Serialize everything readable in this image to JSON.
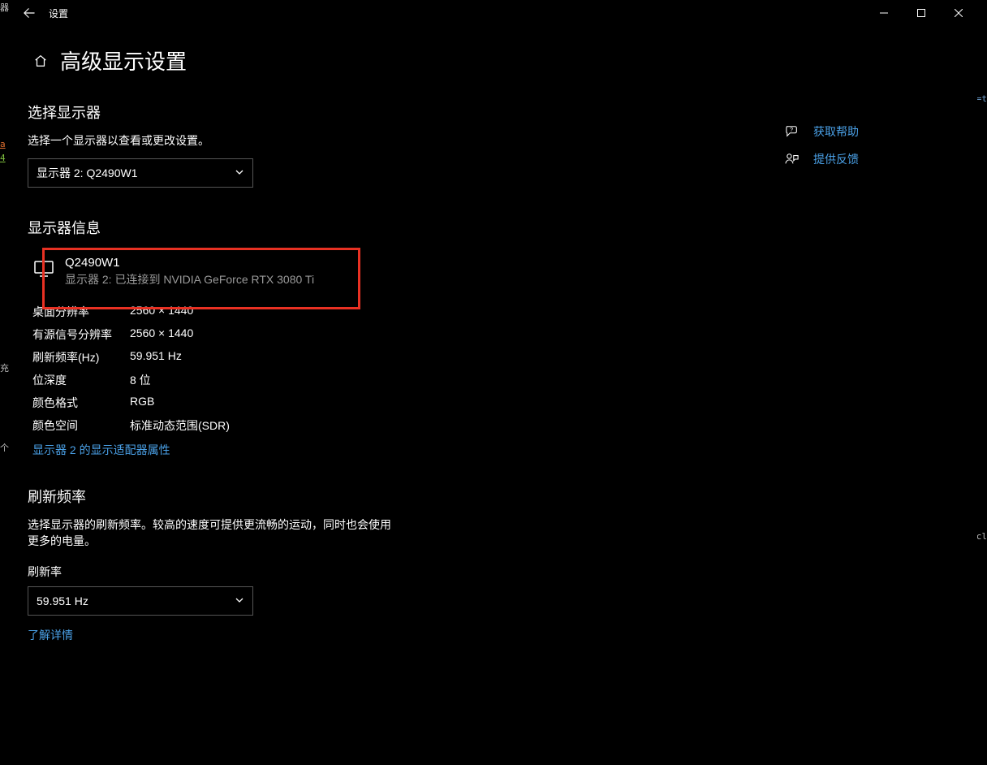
{
  "titlebar": {
    "app_title": "设置"
  },
  "page": {
    "title": "高级显示设置"
  },
  "select_display": {
    "heading": "选择显示器",
    "help": "选择一个显示器以查看或更改设置。",
    "dropdown_value": "显示器 2: Q2490W1"
  },
  "info": {
    "heading": "显示器信息",
    "monitor_name": "Q2490W1",
    "monitor_sub": "显示器 2: 已连接到 NVIDIA GeForce RTX 3080 Ti",
    "rows": [
      {
        "key": "桌面分辨率",
        "val": "2560 × 1440"
      },
      {
        "key": "有源信号分辨率",
        "val": "2560 × 1440"
      },
      {
        "key": "刷新频率(Hz)",
        "val": "59.951 Hz"
      },
      {
        "key": "位深度",
        "val": "8 位"
      },
      {
        "key": "颜色格式",
        "val": "RGB"
      },
      {
        "key": "颜色空间",
        "val": "标准动态范围(SDR)"
      }
    ],
    "adapter_link": "显示器 2 的显示适配器属性"
  },
  "refresh": {
    "heading": "刷新频率",
    "help": "选择显示器的刷新频率。较高的速度可提供更流畅的运动，同时也会使用更多的电量。",
    "label": "刷新率",
    "dropdown_value": "59.951 Hz",
    "learn_more": "了解详情"
  },
  "side": {
    "help": "获取帮助",
    "feedback": "提供反馈"
  },
  "bg_hints": {
    "tl": "器",
    "a": "a",
    "b": "4",
    "c": "充",
    "d": "个",
    "right_top": "=t",
    "right_mid": "cl"
  }
}
